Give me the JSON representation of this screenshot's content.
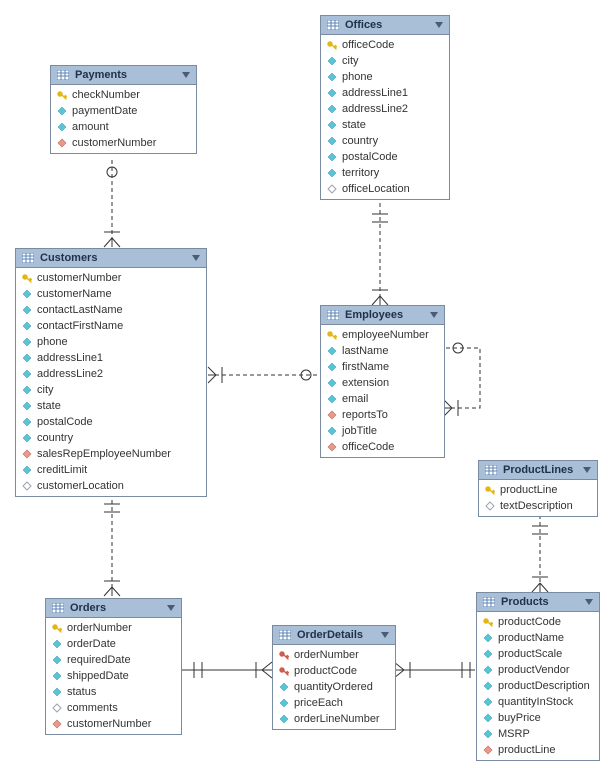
{
  "entities": {
    "payments": {
      "title": "Payments",
      "rows": [
        {
          "icon": "key",
          "label": "checkNumber"
        },
        {
          "icon": "blue",
          "label": "paymentDate"
        },
        {
          "icon": "blue",
          "label": "amount"
        },
        {
          "icon": "red",
          "label": "customerNumber"
        }
      ]
    },
    "offices": {
      "title": "Offices",
      "rows": [
        {
          "icon": "key",
          "label": "officeCode"
        },
        {
          "icon": "blue",
          "label": "city"
        },
        {
          "icon": "blue",
          "label": "phone"
        },
        {
          "icon": "blue",
          "label": "addressLine1"
        },
        {
          "icon": "blue",
          "label": "addressLine2"
        },
        {
          "icon": "blue",
          "label": "state"
        },
        {
          "icon": "blue",
          "label": "country"
        },
        {
          "icon": "blue",
          "label": "postalCode"
        },
        {
          "icon": "blue",
          "label": "territory"
        },
        {
          "icon": "hollow",
          "label": "officeLocation"
        }
      ]
    },
    "customers": {
      "title": "Customers",
      "rows": [
        {
          "icon": "key",
          "label": "customerNumber"
        },
        {
          "icon": "blue",
          "label": "customerName"
        },
        {
          "icon": "blue",
          "label": "contactLastName"
        },
        {
          "icon": "blue",
          "label": "contactFirstName"
        },
        {
          "icon": "blue",
          "label": "phone"
        },
        {
          "icon": "blue",
          "label": "addressLine1"
        },
        {
          "icon": "blue",
          "label": "addressLine2"
        },
        {
          "icon": "blue",
          "label": "city"
        },
        {
          "icon": "blue",
          "label": "state"
        },
        {
          "icon": "blue",
          "label": "postalCode"
        },
        {
          "icon": "blue",
          "label": "country"
        },
        {
          "icon": "red",
          "label": "salesRepEmployeeNumber"
        },
        {
          "icon": "blue",
          "label": "creditLimit"
        },
        {
          "icon": "hollow",
          "label": "customerLocation"
        }
      ]
    },
    "employees": {
      "title": "Employees",
      "rows": [
        {
          "icon": "key",
          "label": "employeeNumber"
        },
        {
          "icon": "blue",
          "label": "lastName"
        },
        {
          "icon": "blue",
          "label": "firstName"
        },
        {
          "icon": "blue",
          "label": "extension"
        },
        {
          "icon": "blue",
          "label": "email"
        },
        {
          "icon": "red",
          "label": "reportsTo"
        },
        {
          "icon": "blue",
          "label": "jobTitle"
        },
        {
          "icon": "red",
          "label": "officeCode"
        }
      ]
    },
    "productlines": {
      "title": "ProductLines",
      "rows": [
        {
          "icon": "key",
          "label": "productLine"
        },
        {
          "icon": "hollow",
          "label": "textDescription"
        }
      ]
    },
    "orders": {
      "title": "Orders",
      "rows": [
        {
          "icon": "key",
          "label": "orderNumber"
        },
        {
          "icon": "blue",
          "label": "orderDate"
        },
        {
          "icon": "blue",
          "label": "requiredDate"
        },
        {
          "icon": "blue",
          "label": "shippedDate"
        },
        {
          "icon": "blue",
          "label": "status"
        },
        {
          "icon": "hollow",
          "label": "comments"
        },
        {
          "icon": "red",
          "label": "customerNumber"
        }
      ]
    },
    "orderdetails": {
      "title": "OrderDetails",
      "rows": [
        {
          "icon": "redkey",
          "label": "orderNumber"
        },
        {
          "icon": "redkey",
          "label": "productCode"
        },
        {
          "icon": "blue",
          "label": "quantityOrdered"
        },
        {
          "icon": "blue",
          "label": "priceEach"
        },
        {
          "icon": "blue",
          "label": "orderLineNumber"
        }
      ]
    },
    "products": {
      "title": "Products",
      "rows": [
        {
          "icon": "key",
          "label": "productCode"
        },
        {
          "icon": "blue",
          "label": "productName"
        },
        {
          "icon": "blue",
          "label": "productScale"
        },
        {
          "icon": "blue",
          "label": "productVendor"
        },
        {
          "icon": "blue",
          "label": "productDescription"
        },
        {
          "icon": "blue",
          "label": "quantityInStock"
        },
        {
          "icon": "blue",
          "label": "buyPrice"
        },
        {
          "icon": "blue",
          "label": "MSRP"
        },
        {
          "icon": "red",
          "label": "productLine"
        }
      ]
    }
  },
  "relationships": [
    {
      "from": "payments",
      "to": "customers",
      "type": "many-to-one-optional"
    },
    {
      "from": "customers",
      "to": "orders",
      "type": "one-to-many"
    },
    {
      "from": "customers",
      "to": "employees",
      "type": "many-to-one-optional"
    },
    {
      "from": "employees",
      "to": "offices",
      "type": "many-to-one"
    },
    {
      "from": "employees",
      "to": "employees",
      "type": "self-optional"
    },
    {
      "from": "orders",
      "to": "orderdetails",
      "type": "one-to-many"
    },
    {
      "from": "orderdetails",
      "to": "products",
      "type": "many-to-one"
    },
    {
      "from": "products",
      "to": "productlines",
      "type": "many-to-one"
    }
  ]
}
